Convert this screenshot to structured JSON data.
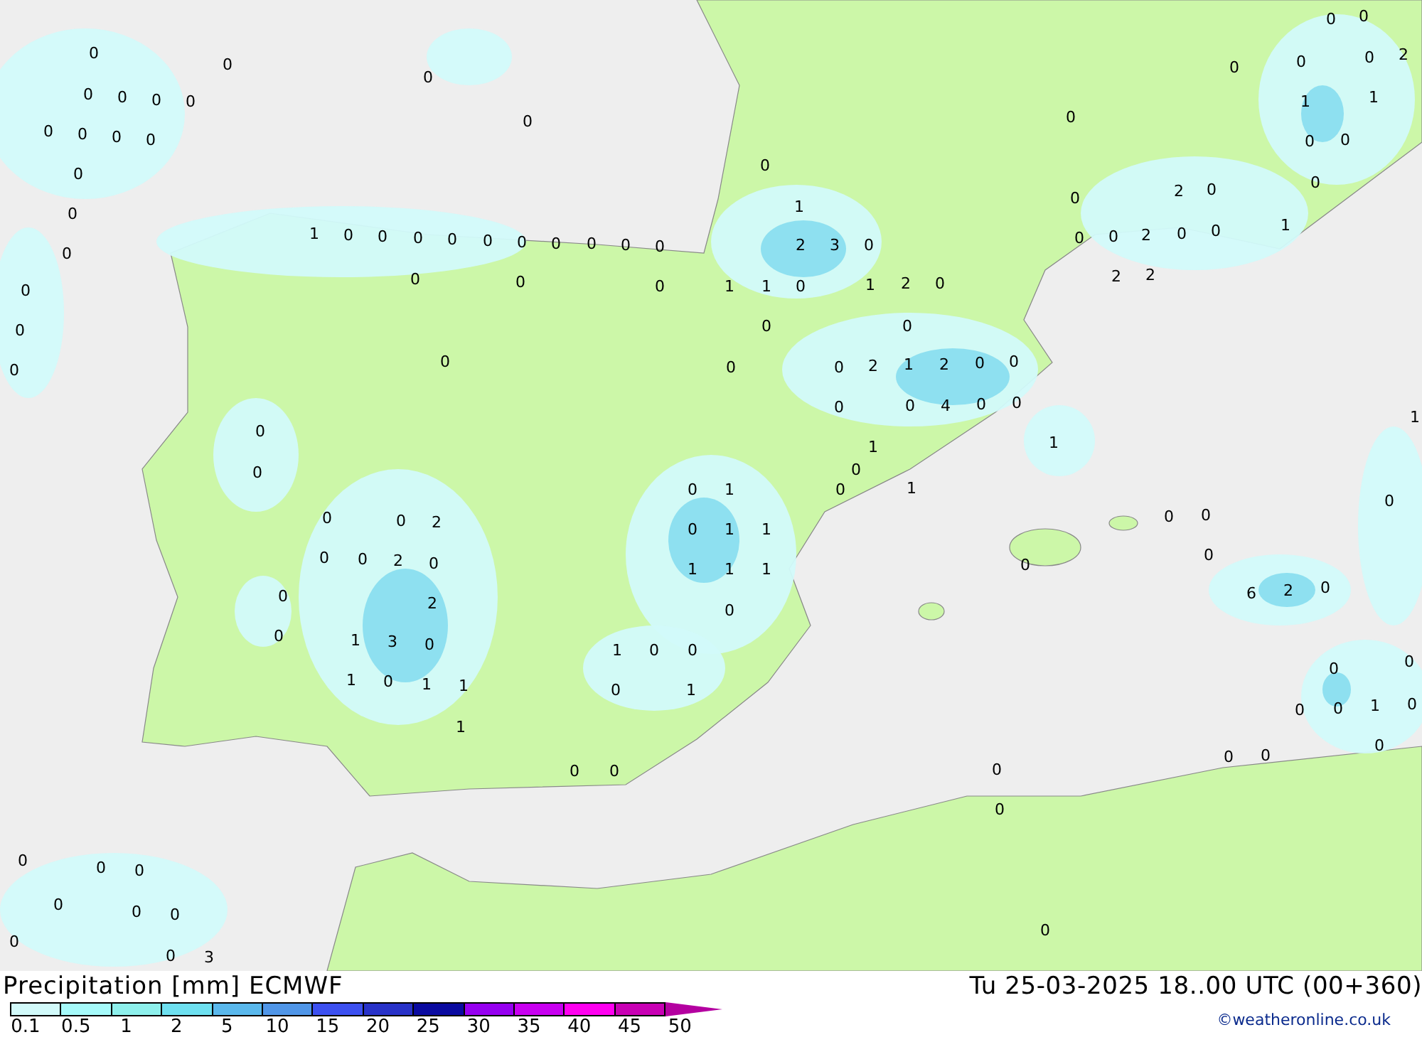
{
  "map_labels": [
    "0",
    "0",
    "0",
    "0",
    "0",
    "0",
    "0",
    "0",
    "0",
    "0",
    "0",
    "0",
    "0",
    "0",
    "0",
    "0",
    "0",
    "0",
    "1",
    "0",
    "0",
    "0",
    "0",
    "0",
    "0",
    "0",
    "0",
    "0",
    "0",
    "0",
    "0",
    "0",
    "1",
    "1",
    "0",
    "1",
    "2",
    "0",
    "0",
    "1",
    "2",
    "3",
    "0",
    "0",
    "0",
    "0",
    "0",
    "0",
    "2",
    "1",
    "2",
    "0",
    "0",
    "0",
    "0",
    "4",
    "0",
    "0",
    "1",
    "0",
    "0",
    "1",
    "1",
    "0",
    "0",
    "0",
    "0",
    "2",
    "0",
    "0",
    "2",
    "0",
    "0",
    "2",
    "0",
    "1",
    "3",
    "0",
    "1",
    "0",
    "1",
    "1",
    "1",
    "0",
    "1",
    "0",
    "1",
    "1",
    "1",
    "1",
    "1",
    "0",
    "1",
    "0",
    "0",
    "0",
    "1",
    "0",
    "0",
    "0",
    "0",
    "2",
    "0",
    "0",
    "0",
    "2",
    "0",
    "0",
    "2",
    "2",
    "1",
    "0",
    "0",
    "0",
    "0",
    "0",
    "0",
    "2",
    "1",
    "1",
    "0",
    "0",
    "0",
    "0",
    "0",
    "0",
    "6",
    "2",
    "0",
    "0",
    "1",
    "0",
    "0",
    "0",
    "0",
    "1",
    "0",
    "0",
    "0",
    "0",
    "0",
    "0",
    "0",
    "0",
    "0",
    "0",
    "0",
    "0",
    "0",
    "0",
    "3",
    "0"
  ],
  "legend": {
    "title": "Precipitation [mm] ECMWF",
    "scale": [
      {
        "color": "#d2fafa"
      },
      {
        "color": "#a6fafa"
      },
      {
        "color": "#8ef0ec"
      },
      {
        "color": "#6ee0f0"
      },
      {
        "color": "#5ab8ec"
      },
      {
        "color": "#5096e8"
      },
      {
        "color": "#3c50f0"
      },
      {
        "color": "#2832c8"
      },
      {
        "color": "#0a0aa0"
      },
      {
        "color": "#9600f0"
      },
      {
        "color": "#c800f0"
      },
      {
        "color": "#ff00f0"
      },
      {
        "color": "#c800b4"
      }
    ],
    "ticks": [
      "0.1",
      "0.5",
      "1",
      "2",
      "5",
      "10",
      "15",
      "20",
      "25",
      "30",
      "35",
      "40",
      "45",
      "50"
    ]
  },
  "timestamp": "Tu 25-03-2025 18..00 UTC (00+360)",
  "credit": "©weatheronline.co.uk"
}
